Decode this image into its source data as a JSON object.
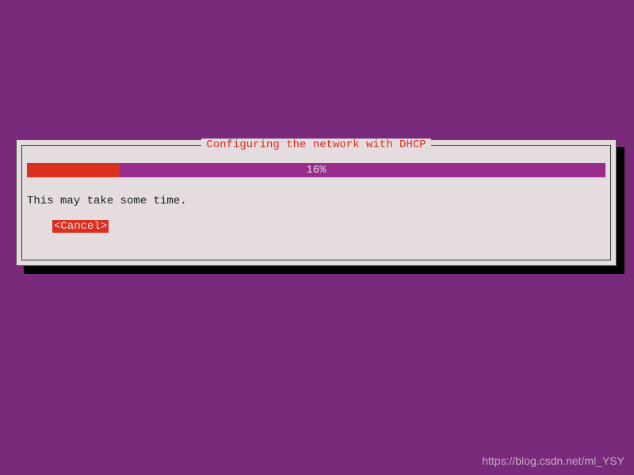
{
  "dialog": {
    "title": "Configuring the network with DHCP",
    "progress_percent": 16,
    "progress_label": "16%",
    "message": "This may take some time.",
    "cancel_label": "<Cancel>"
  },
  "watermark": "https://blog.csdn.net/ml_YSY"
}
